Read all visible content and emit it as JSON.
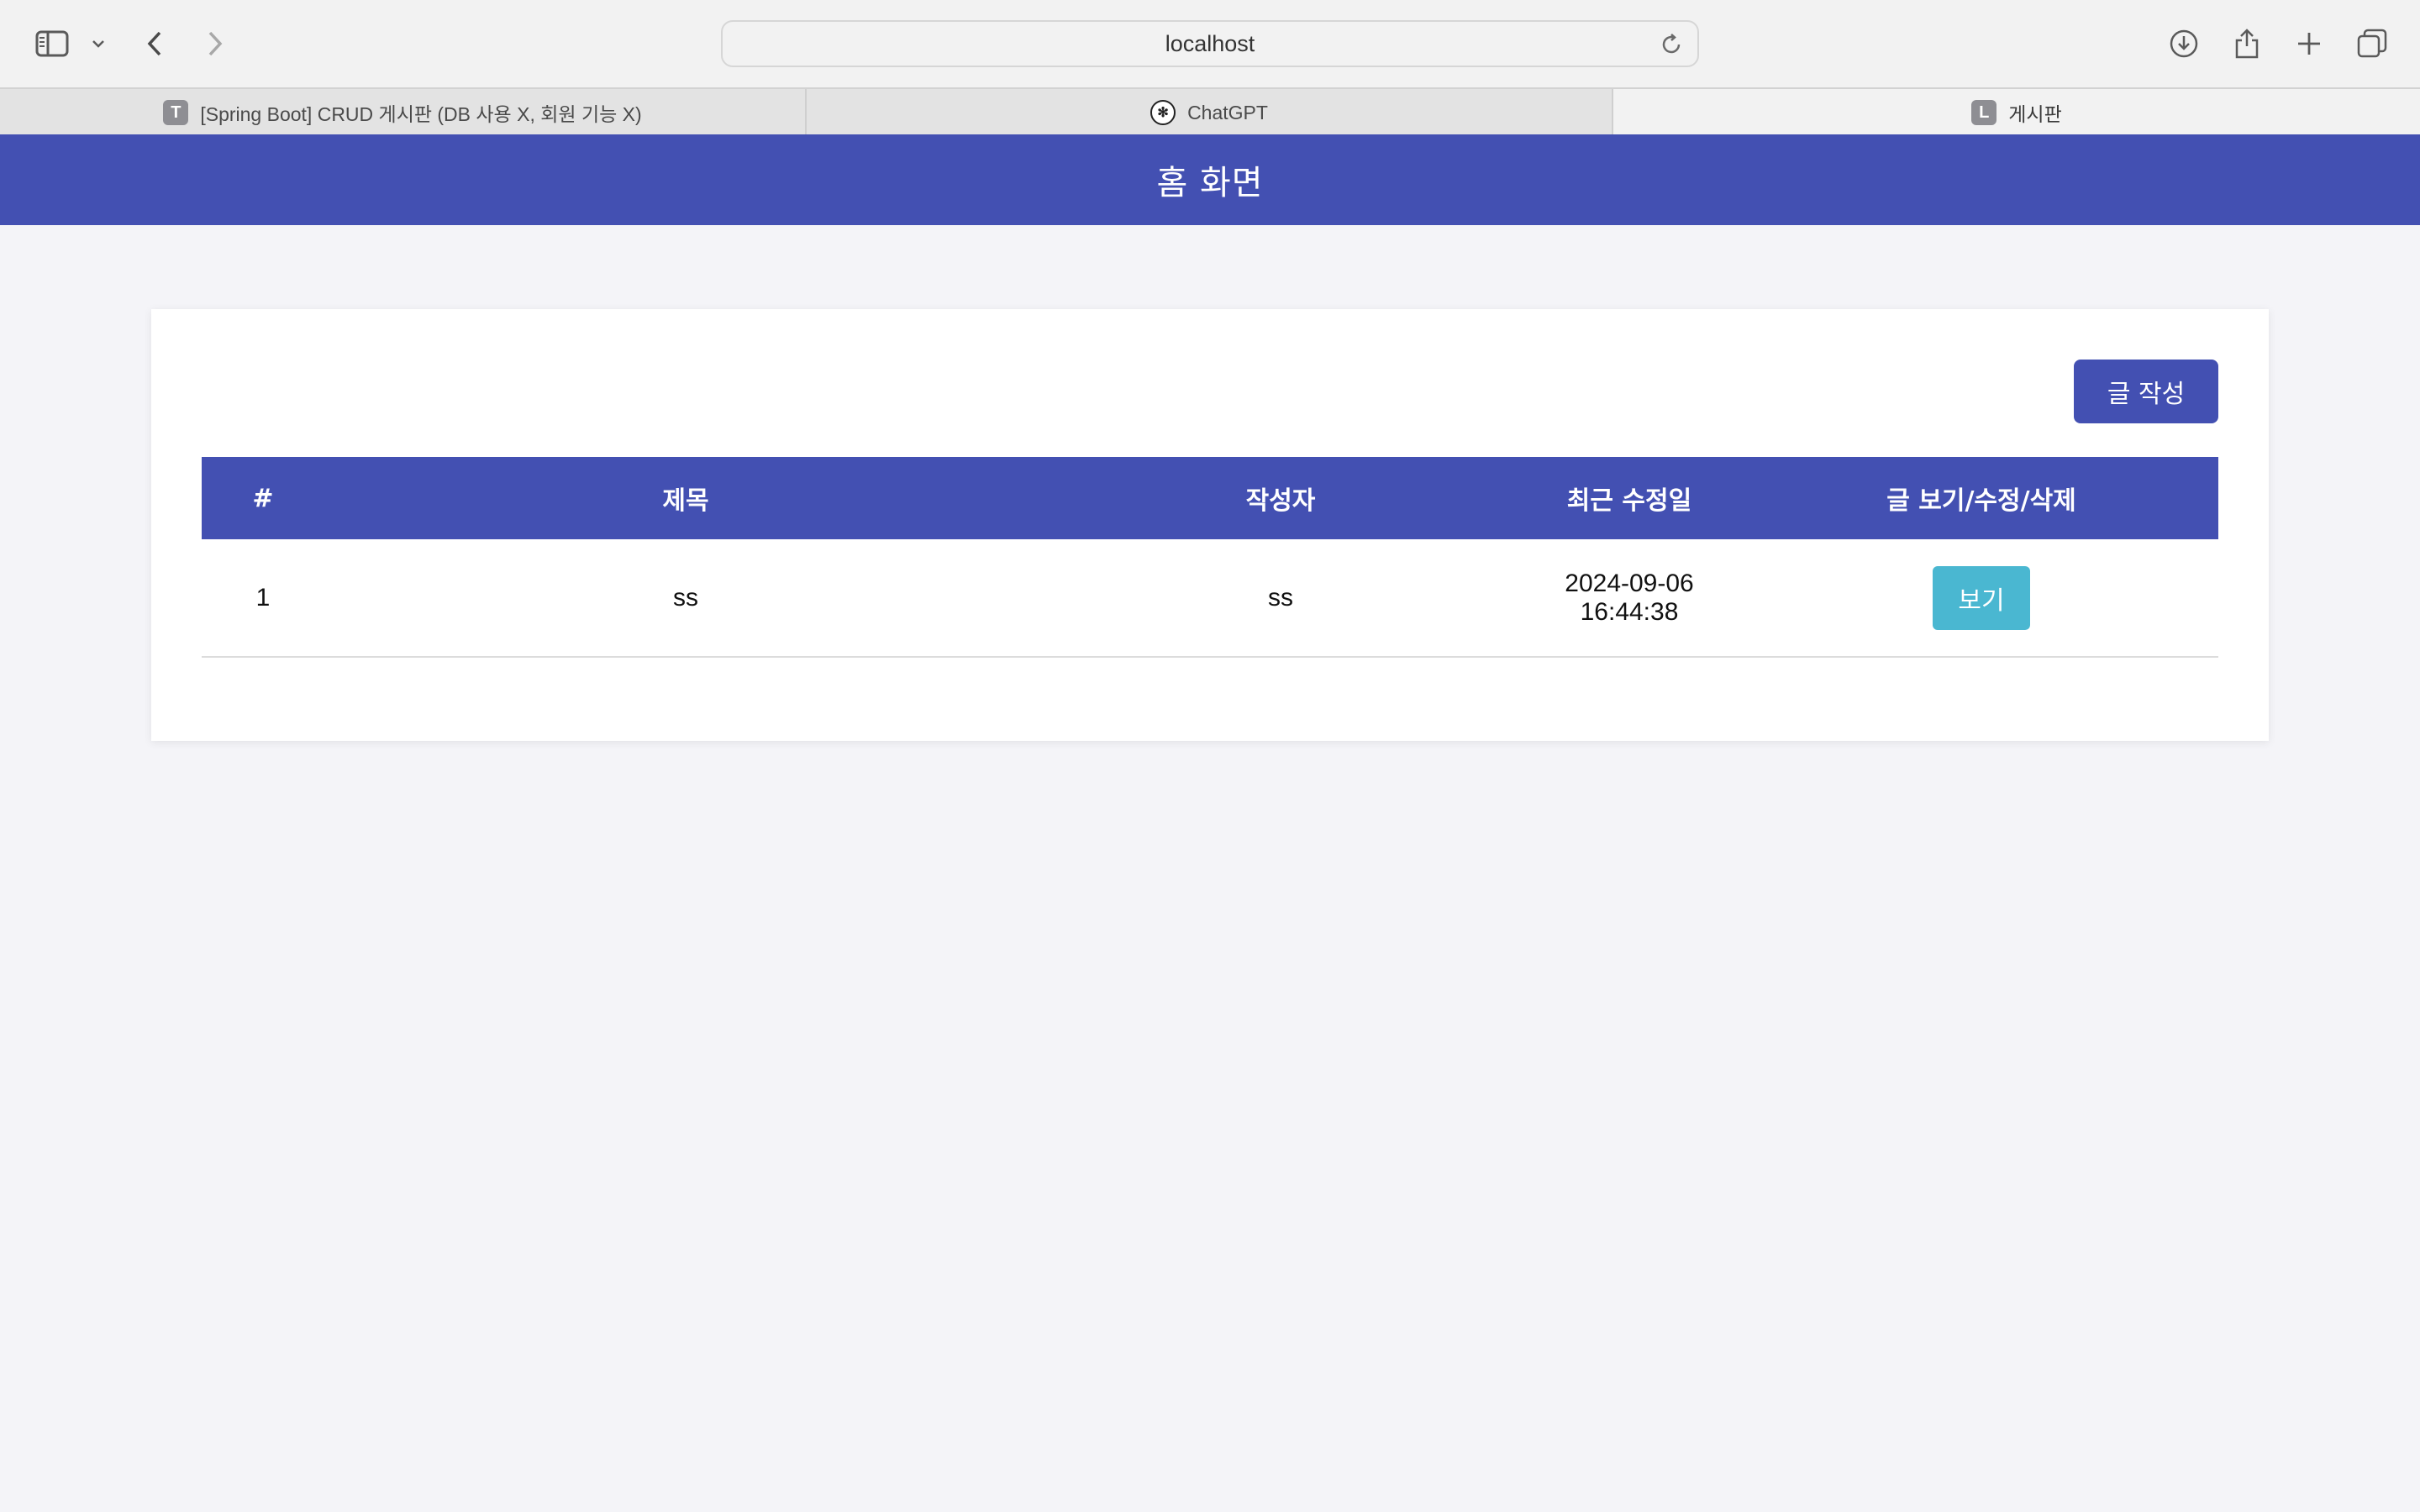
{
  "browser": {
    "address": "localhost",
    "tabs": [
      {
        "label": "[Spring Boot] CRUD 게시판 (DB 사용 X, 회원 기능 X)",
        "favicon": "T"
      },
      {
        "label": "ChatGPT",
        "favicon": "chatgpt-icon"
      },
      {
        "label": "게시판",
        "favicon": "L"
      }
    ]
  },
  "page": {
    "title": "홈 화면",
    "write_button": "글 작성",
    "accent_color": "#4350b2",
    "view_color": "#4ab7d1"
  },
  "table": {
    "headers": [
      "#",
      "제목",
      "작성자",
      "최근 수정일",
      "글 보기/수정/삭제"
    ],
    "rows": [
      {
        "num": "1",
        "title": "ss",
        "author": "ss",
        "date": "2024-09-06 16:44:38",
        "action": "보기"
      }
    ]
  }
}
